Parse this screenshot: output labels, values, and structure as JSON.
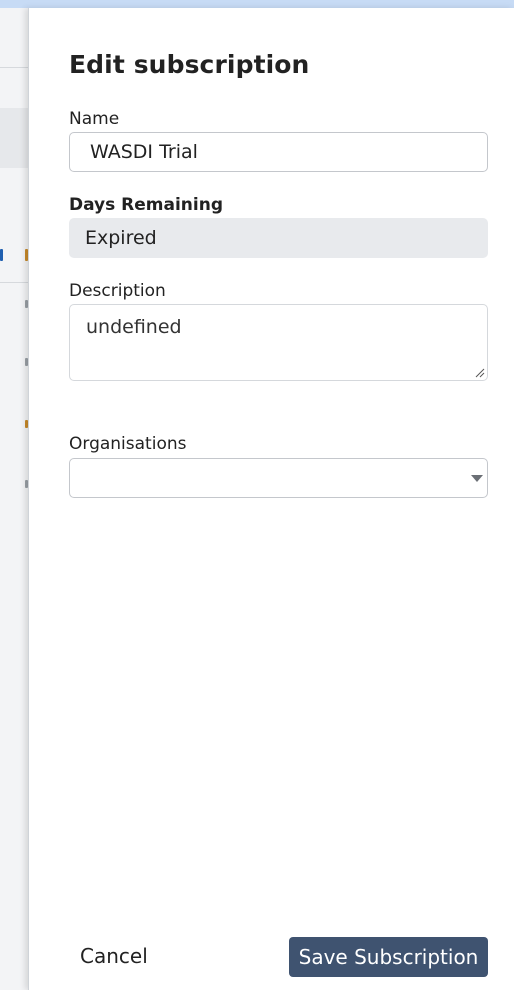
{
  "dialog": {
    "title": "Edit subscription"
  },
  "fields": {
    "name": {
      "label": "Name",
      "value": "WASDI Trial"
    },
    "days_remaining": {
      "label": "Days Remaining",
      "value": "Expired"
    },
    "description": {
      "label": "Description",
      "value": "undefined"
    },
    "organisations": {
      "label": "Organisations",
      "value": ""
    }
  },
  "actions": {
    "cancel_label": "Cancel",
    "save_label": "Save Subscription"
  },
  "colors": {
    "primary_button": "#3f5370",
    "readonly_field": "#e8eaed",
    "top_strip": "#c7dbf5"
  }
}
